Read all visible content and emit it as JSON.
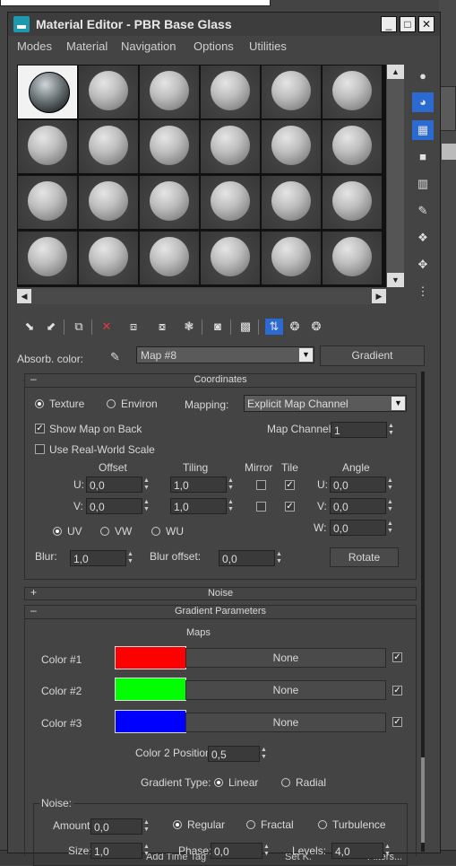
{
  "window": {
    "title": "Material Editor - PBR Base Glass"
  },
  "menu": [
    "Modes",
    "Material",
    "Navigation",
    "Options",
    "Utilities"
  ],
  "background": {
    "bottom_items": [
      "Add Time Tag",
      "Set K.",
      "Filters..."
    ]
  },
  "absorb": {
    "label": "Absorb. color:",
    "map_name": "Map #8",
    "map_type": "Gradient"
  },
  "coordinates": {
    "title": "Coordinates",
    "texture_label": "Texture",
    "environ_label": "Environ",
    "mapping_label": "Mapping:",
    "mapping_value": "Explicit Map Channel",
    "show_map_label": "Show Map on Back",
    "map_channel_label": "Map Channel:",
    "map_channel_value": "1",
    "real_world_label": "Use Real-World Scale",
    "offset_label": "Offset",
    "tiling_label": "Tiling",
    "mirror_label": "Mirror",
    "tile_label": "Tile",
    "angle_label": "Angle",
    "u_label": "U:",
    "v_label": "V:",
    "w_label": "W:",
    "u_offset": "0,0",
    "v_offset": "0,0",
    "u_tiling": "1,0",
    "v_tiling": "1,0",
    "u_angle": "0,0",
    "v_angle": "0,0",
    "w_angle": "0,0",
    "uv_label": "UV",
    "vw_label": "VW",
    "wu_label": "WU",
    "blur_label": "Blur:",
    "blur_value": "1,0",
    "blur_offset_label": "Blur offset:",
    "blur_offset_value": "0,0",
    "rotate_label": "Rotate"
  },
  "noise_rollout": {
    "title": "Noise",
    "toggle": "+"
  },
  "gradient": {
    "title": "Gradient Parameters",
    "toggle": "–",
    "maps_label": "Maps",
    "colors": [
      {
        "label": "Color #1",
        "hex": "#ff0000",
        "map": "None"
      },
      {
        "label": "Color #2",
        "hex": "#00ff00",
        "map": "None"
      },
      {
        "label": "Color #3",
        "hex": "#0000ff",
        "map": "None"
      }
    ],
    "position_label": "Color 2 Position:",
    "position_value": "0,5",
    "type_label": "Gradient Type:",
    "linear_label": "Linear",
    "radial_label": "Radial",
    "noise_group_label": "Noise:",
    "amount_label": "Amount:",
    "amount_value": "0,0",
    "regular_label": "Regular",
    "fractal_label": "Fractal",
    "turbulence_label": "Turbulence",
    "size_label": "Size:",
    "size_value": "1,0",
    "phase_label": "Phase:",
    "phase_value": "0,0",
    "levels_label": "Levels:",
    "levels_value": "4,0"
  },
  "colors": {
    "accent": "#2b6bd1",
    "panel": "#444444"
  }
}
